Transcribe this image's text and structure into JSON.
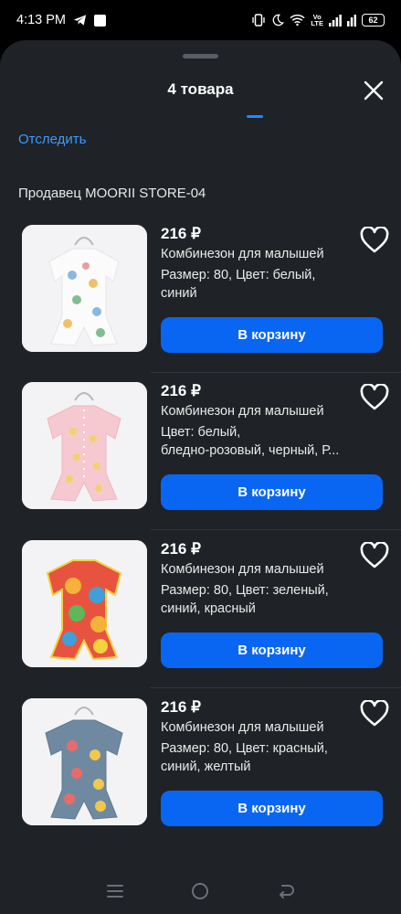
{
  "status": {
    "time": "4:13 PM",
    "volte_top": "Vo",
    "volte_bottom": "LTE",
    "battery": "62"
  },
  "sheet": {
    "title": "4 товара",
    "track_label": "Отследить",
    "seller_label": "Продавец MOORII STORE-04"
  },
  "items": [
    {
      "price": "216 ₽",
      "name": "Комбинезон для малышей",
      "props_line1": "Размер: 80, Цвет: белый,",
      "props_line2": "синий",
      "cart_label": "В корзину",
      "image": "white romper with dinosaur print"
    },
    {
      "price": "216 ₽",
      "name": "Комбинезон для малышей",
      "props_line1": "Цвет: белый,",
      "props_line2": "бледно-розовый, черный, Р...",
      "cart_label": "В корзину",
      "image": "pink romper with bee print"
    },
    {
      "price": "216 ₽",
      "name": "Комбинезон для малышей",
      "props_line1": "Размер: 80, Цвет: зеленый,",
      "props_line2": "синий, красный",
      "cart_label": "В корзину",
      "image": "multicolor romper with lion print"
    },
    {
      "price": "216 ₽",
      "name": "Комбинезон для малышей",
      "props_line1": "Размер: 80, Цвет: красный,",
      "props_line2": "синий, желтый",
      "cart_label": "В корзину",
      "image": "gray-blue romper with fruit print"
    }
  ],
  "icons": {
    "telegram": "telegram-icon",
    "heart": "heart-outline-icon",
    "close": "close-icon"
  },
  "colors": {
    "accent": "#0966f3",
    "link": "#3d9bff",
    "sheet_bg": "#1f2226"
  }
}
